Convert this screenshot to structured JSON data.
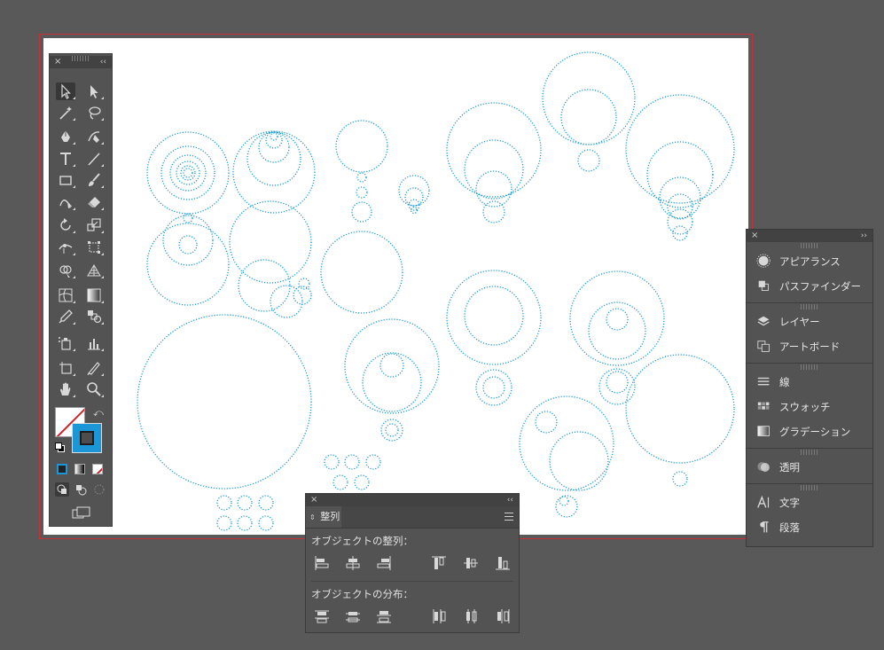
{
  "tools_panel": {
    "close_label": "×",
    "collapse_label": "‹‹",
    "tools": [
      "selection-tool",
      "direct-selection-tool",
      "magic-wand-tool",
      "lasso-tool",
      "pen-tool",
      "curvature-tool",
      "type-tool",
      "line-segment-tool",
      "rectangle-tool",
      "paintbrush-tool",
      "shaper-tool",
      "eraser-tool",
      "rotate-tool",
      "scale-tool",
      "width-tool",
      "free-transform-tool",
      "shape-builder-tool",
      "perspective-grid-tool",
      "mesh-tool",
      "gradient-tool",
      "eyedropper-tool",
      "blend-tool",
      "symbol-sprayer-tool",
      "column-graph-tool",
      "artboard-tool",
      "slice-tool",
      "hand-tool",
      "zoom-tool"
    ],
    "fill_stroke": {
      "fill": "none",
      "stroke_color": "#1b96d6"
    },
    "draw_modes": [
      "draw-normal",
      "draw-behind",
      "draw-inside"
    ]
  },
  "align_panel": {
    "close_label": "×",
    "collapse_label": "‹‹",
    "tab_label": "整列",
    "section_align_label": "オブジェクトの整列：",
    "section_distribute_label": "オブジェクトの分布：",
    "align_buttons": [
      "horizontal-align-left",
      "horizontal-align-center",
      "horizontal-align-right",
      "vertical-align-top",
      "vertical-align-center",
      "vertical-align-bottom"
    ],
    "distribute_buttons": [
      "vertical-distribute-top",
      "vertical-distribute-center",
      "vertical-distribute-bottom",
      "horizontal-distribute-left",
      "horizontal-distribute-center",
      "horizontal-distribute-right"
    ]
  },
  "right_panels": {
    "close_label": "×",
    "expand_label": "››",
    "groups": [
      [
        {
          "label": "アピアランス",
          "icon": "appearance-icon"
        },
        {
          "label": "パスファインダー",
          "icon": "pathfinder-icon"
        }
      ],
      [
        {
          "label": "レイヤー",
          "icon": "layers-icon"
        },
        {
          "label": "アートボード",
          "icon": "artboards-icon"
        }
      ],
      [
        {
          "label": "線",
          "icon": "stroke-icon"
        },
        {
          "label": "スウォッチ",
          "icon": "swatches-icon"
        },
        {
          "label": "グラデーション",
          "icon": "gradient-icon"
        }
      ],
      [
        {
          "label": "透明",
          "icon": "transparency-icon"
        }
      ],
      [
        {
          "label": "文字",
          "icon": "character-icon"
        },
        {
          "label": "段落",
          "icon": "paragraph-icon"
        }
      ]
    ]
  },
  "canvas": {
    "circle_stroke_color": "#1b9bd6",
    "artboard_border_color": "#c8303a"
  }
}
